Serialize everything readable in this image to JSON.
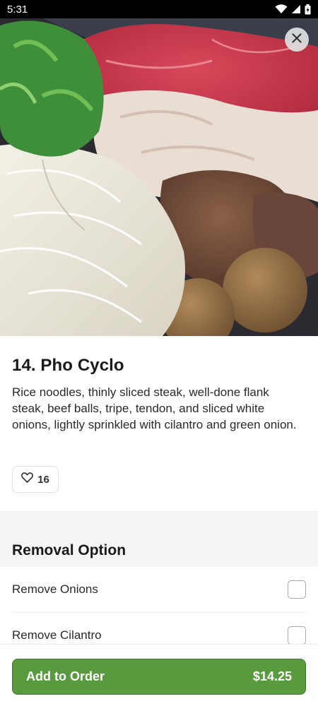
{
  "status_bar": {
    "time": "5:31",
    "icons": [
      "wifi-icon",
      "signal-icon",
      "battery-icon"
    ]
  },
  "hero": {
    "image_alt": "Pho Cyclo with steak, beef balls, onions and cilantro",
    "close_icon": "close-icon"
  },
  "item": {
    "title": "14. Pho Cyclo",
    "description": "Rice noodles, thinly sliced steak, well-done flank steak, beef balls, tripe, tendon, and sliced white onions, lightly sprinkled with cilantro and green onion.",
    "likes": "16",
    "like_icon": "heart-icon"
  },
  "removal": {
    "title": "Removal Option",
    "options": [
      {
        "label": "Remove Onions",
        "checked": false
      },
      {
        "label": "Remove Cilantro",
        "checked": false
      }
    ]
  },
  "cta": {
    "label": "Add to Order",
    "price": "$14.25"
  },
  "colors": {
    "accent": "#5a9a3e",
    "status_bar": "#000000"
  }
}
